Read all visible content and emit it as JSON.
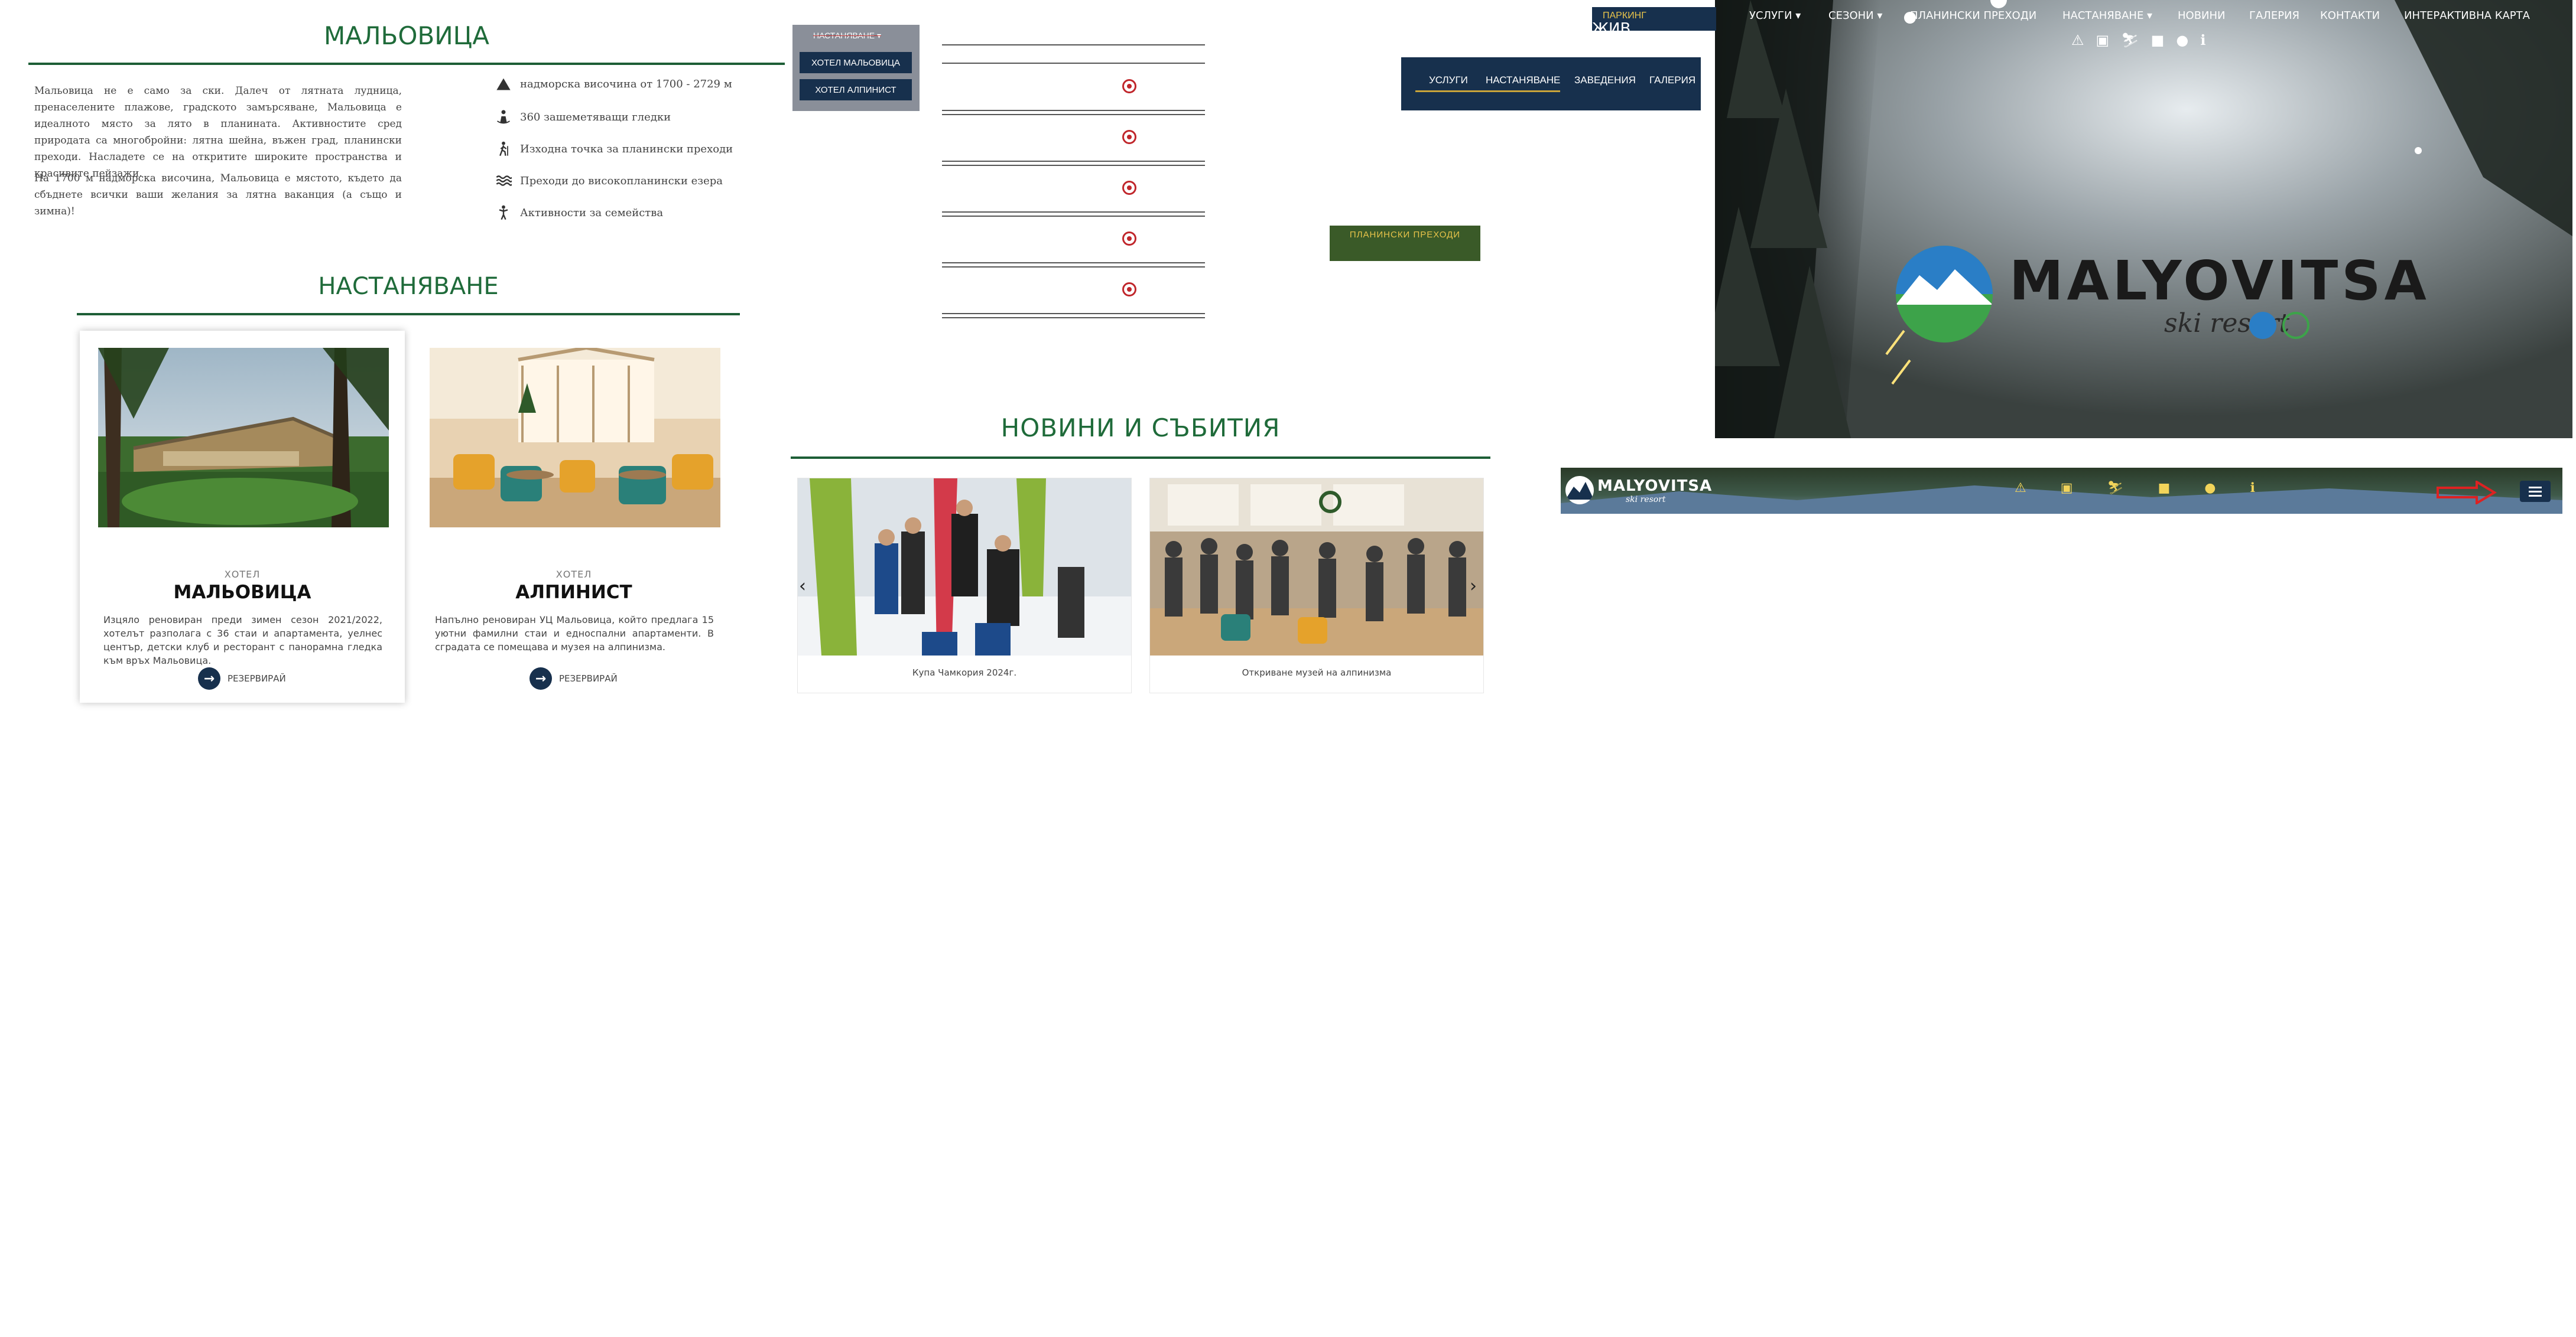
{
  "about": {
    "title": "МАЛЬОВИЦА",
    "paragraphs": [
      "Мальовица не е само за ски. Далеч от лятната лудница, пренаселените плажове, градското замърсяване, Мальовица е идеалното място за лято в планината. Активностите сред природата са многобройни: лятна шейна, въжен град, планински преходи. Насладете се на откритите широките пространства и красивите пейзажи.",
      "На 1700 м надморска височина, Мальовица е мястото, където да сбъднете всички ваши желания за лятна ваканция (а също и зимна)!"
    ],
    "features": [
      {
        "icon": "mountain-icon",
        "text": "надморска височина от 1700 - 2729 м"
      },
      {
        "icon": "panorama-icon",
        "text": "360 зашеметяващи гледки"
      },
      {
        "icon": "hiker-icon",
        "text": "Изходна точка за планински преходи"
      },
      {
        "icon": "waves-icon",
        "text": "Преходи до високопланински езера"
      },
      {
        "icon": "family-icon",
        "text": "Активности за семейства"
      }
    ]
  },
  "accommodation": {
    "title": "НАСТАНЯВАНЕ",
    "cards": [
      {
        "kind": "ХОТЕЛ",
        "name": "МАЛЬОВИЦА",
        "desc": "Изцяло реновиран преди зимен сезон 2021/2022, хотелът разполага с 36 стаи и апартамента, уелнес център, детски клуб и ресторант с панорамна гледка към връх Мальовица.",
        "reserve": "РЕЗЕРВИРАЙ"
      },
      {
        "kind": "ХОТЕЛ",
        "name": "АЛПИНИСТ",
        "desc": "Напълно реновиран УЦ Мальовица, който предлага 15 уютни фамилни стаи и едноспални апартаменти. В сградата се помещава и музея на алпинизма.",
        "reserve": "РЕЗЕРВИРАЙ"
      }
    ]
  },
  "dropdown": {
    "head": "НАСТАНЯВАНЕ",
    "items": [
      "ХОТЕЛ МАЛЬОВИЦА",
      "ХОТЕЛ АЛПИНИСТ"
    ]
  },
  "small_nav": {
    "items": [
      "УСЛУГИ",
      "НАСТАНЯВАНЕ",
      "ЗАВЕДЕНИЯ",
      "ГАЛЕРИЯ"
    ]
  },
  "hiking_button": "ПЛАНИНСКИ ПРЕХОДИ",
  "news": {
    "title": "НОВИНИ И СЪБИТИЯ",
    "items": [
      {
        "caption": "Купа Чамкория 2024г."
      },
      {
        "caption": "Откриване музей на алпинизма"
      }
    ],
    "prev": "‹",
    "next": "›"
  },
  "hero": {
    "parking": "ПАРКИНГ",
    "partial_label": "ЖИВ",
    "menu": [
      "УСЛУГИ ▾",
      "СЕЗОНИ ▾",
      "ПЛАНИНСКИ ПРЕХОДИ",
      "НАСТАНЯВАНЕ ▾",
      "НОВИНИ",
      "ГАЛЕРИЯ",
      "КОНТАКТИ",
      "ИНТЕРАКТИВНА КАРТА"
    ],
    "logo_text": "MALYOVITSA",
    "logo_sub": "ski resort"
  },
  "sticky_bar": {
    "logo_text": "MALYOVITSA",
    "logo_sub": "ski resort"
  },
  "colors": {
    "brand_green": "#1d5e36",
    "navy": "#17304d",
    "accent_red": "#c0262b",
    "gold": "#e8c34a"
  }
}
